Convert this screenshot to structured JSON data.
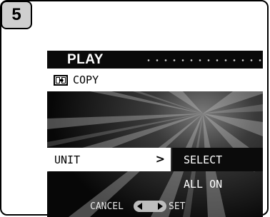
{
  "step": {
    "number": "5"
  },
  "screen": {
    "title": "PLAY",
    "menu_item": {
      "icon": "copy-icon",
      "label": "COPY"
    },
    "unit_row": {
      "label": "UNIT",
      "arrow": ">",
      "selected_value": "SELECT"
    },
    "options": {
      "other": "ALL ON"
    },
    "footer": {
      "cancel_label": "CANCEL",
      "set_label": "SET",
      "dpad_icon": "left-right-arrows-icon"
    }
  },
  "colors": {
    "screen_bg": "#0a0a0a",
    "highlight": "#ffffff",
    "badge_bg": "#cfcfcf"
  }
}
